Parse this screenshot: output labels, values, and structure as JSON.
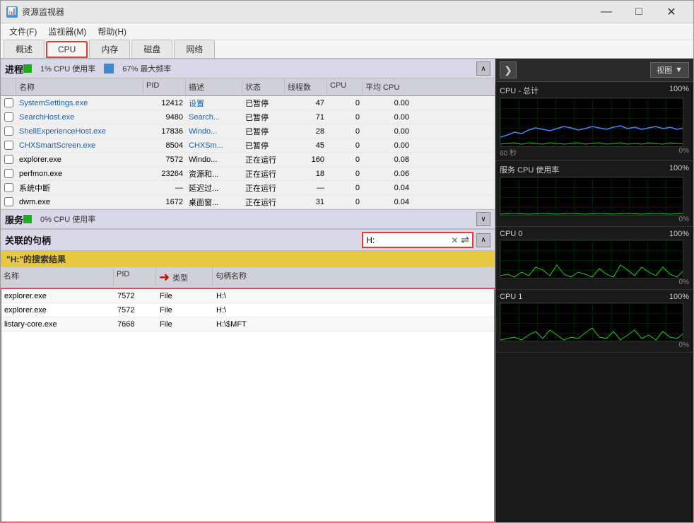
{
  "window": {
    "title": "资源监视器",
    "icon": "📊"
  },
  "titlebar": {
    "title": "资源监视器",
    "minimize": "—",
    "maximize": "□",
    "close": "✕"
  },
  "menu": {
    "items": [
      "文件(F)",
      "监视器(M)",
      "帮助(H)"
    ]
  },
  "tabs": [
    {
      "label": "概述",
      "active": false
    },
    {
      "label": "CPU",
      "active": true
    },
    {
      "label": "内存",
      "active": false
    },
    {
      "label": "磁盘",
      "active": false
    },
    {
      "label": "网络",
      "active": false
    }
  ],
  "process_section": {
    "title": "进程",
    "cpu_usage": "1% CPU 使用率",
    "max_freq": "67% 最大频率",
    "columns": [
      "",
      "名称",
      "PID",
      "描述",
      "状态",
      "线程数",
      "CPU",
      "平均 CPU"
    ],
    "rows": [
      {
        "name": "SystemSettings.exe",
        "pid": "12412",
        "desc": "设置",
        "state": "已暂停",
        "threads": "47",
        "cpu": "0",
        "avg_cpu": "0.00"
      },
      {
        "name": "SearchHost.exe",
        "pid": "9480",
        "desc": "Search...",
        "state": "已暂停",
        "threads": "71",
        "cpu": "0",
        "avg_cpu": "0.00"
      },
      {
        "name": "ShellExperienceHost.exe",
        "pid": "17836",
        "desc": "Windo...",
        "state": "已暂停",
        "threads": "28",
        "cpu": "0",
        "avg_cpu": "0.00"
      },
      {
        "name": "CHXSmartScreen.exe",
        "pid": "8504",
        "desc": "CHXSm...",
        "state": "已暂停",
        "threads": "45",
        "cpu": "0",
        "avg_cpu": "0.00"
      },
      {
        "name": "explorer.exe",
        "pid": "7572",
        "desc": "Windo...",
        "state": "正在运行",
        "threads": "160",
        "cpu": "0",
        "avg_cpu": "0.08"
      },
      {
        "name": "perfmon.exe",
        "pid": "23264",
        "desc": "资源和...",
        "state": "正在运行",
        "threads": "18",
        "cpu": "0",
        "avg_cpu": "0.06"
      },
      {
        "name": "系统中断",
        "pid": "—",
        "desc": "延迟过...",
        "state": "正在运行",
        "threads": "—",
        "cpu": "0",
        "avg_cpu": "0.04"
      },
      {
        "name": "dwm.exe",
        "pid": "1672",
        "desc": "桌面窗...",
        "state": "正在运行",
        "threads": "31",
        "cpu": "0",
        "avg_cpu": "0.04"
      }
    ]
  },
  "services_section": {
    "title": "服务",
    "cpu_usage": "0% CPU 使用率"
  },
  "handles_section": {
    "title": "关联的句柄",
    "search_value": "H:",
    "search_result_label": "\"H:\"的搜索结果",
    "columns": [
      "名称",
      "PID",
      "类型",
      "句柄名称"
    ],
    "rows": [
      {
        "name": "explorer.exe",
        "pid": "7572",
        "type": "File",
        "handle": "H:\\"
      },
      {
        "name": "explorer.exe",
        "pid": "7572",
        "type": "File",
        "handle": "H:\\"
      },
      {
        "name": "listary-core.exe",
        "pid": "7668",
        "type": "File",
        "handle": "H:\\$MFT"
      }
    ]
  },
  "right_panel": {
    "nav_arrow": "❯",
    "view_label": "视图",
    "dropdown_arrow": "▼",
    "graphs": [
      {
        "label": "CPU - 总计",
        "percent": "100%",
        "time_label": "60 秒",
        "zero_label": "0%",
        "size": "large"
      },
      {
        "label": "服务 CPU 使用率",
        "percent": "100%",
        "zero_label": "0%",
        "size": "medium"
      },
      {
        "label": "CPU 0",
        "percent": "100%",
        "zero_label": "0%",
        "size": "medium"
      },
      {
        "label": "CPU 1",
        "percent": "100%",
        "zero_label": "0%",
        "size": "medium"
      }
    ]
  }
}
